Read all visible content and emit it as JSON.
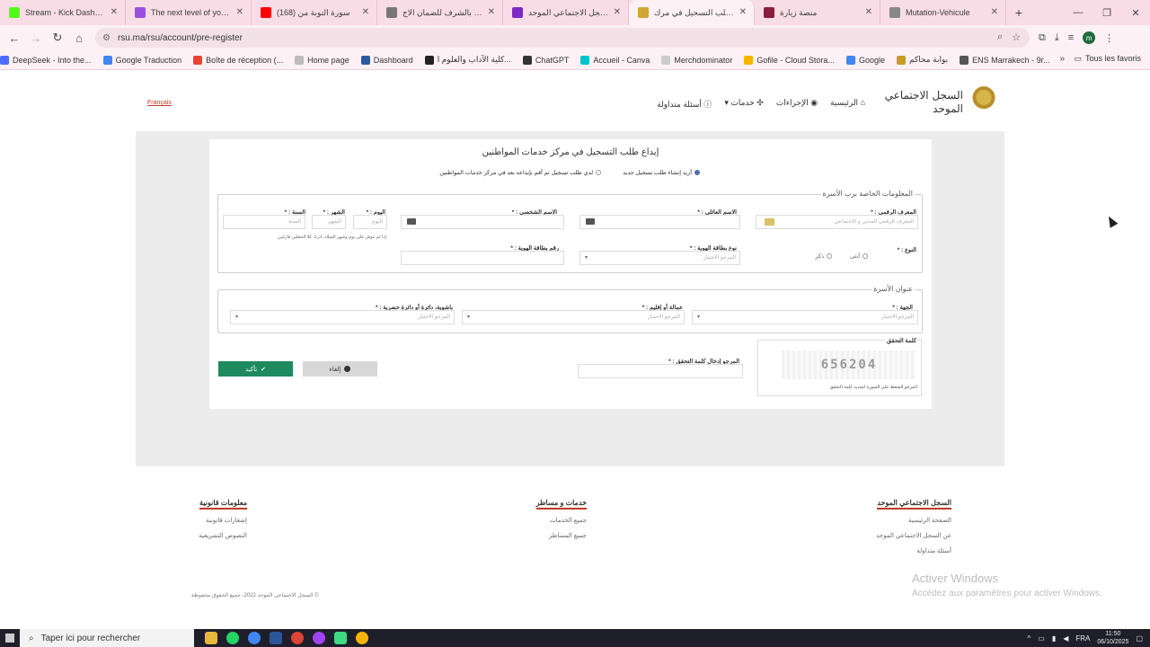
{
  "browser": {
    "tabs": [
      {
        "title": "Stream - Kick Dashboard",
        "favicon_color": "#53fc18",
        "active": false
      },
      {
        "title": "The next level of your cre",
        "favicon_color": "#9b51e0",
        "active": false
      },
      {
        "title": "(168) سورة التوبة من",
        "favicon_color": "#ff0000",
        "active": false
      },
      {
        "title": "تصريح بالشرف للضمان الاج",
        "favicon_color": "#777777",
        "active": false
      },
      {
        "title": "السجل الاجتماعي الموحد -",
        "favicon_color": "#7b2cbf",
        "active": false
      },
      {
        "title": "إيداع طلب التسجيل في مرك",
        "favicon_color": "#d4a537",
        "active": true
      },
      {
        "title": "منصة زيارة",
        "favicon_color": "#8a1c3d",
        "active": false
      },
      {
        "title": "Mutation-Vehicule",
        "favicon_color": "#888888",
        "active": false
      }
    ],
    "url": "rsu.ma/rsu/account/pre-register",
    "bookmarks": [
      {
        "label": "DeepSeek - Into the...",
        "color": "#4d6bfe"
      },
      {
        "label": "Google Traduction",
        "color": "#4285f4"
      },
      {
        "label": "Boîte de réception (...",
        "color": "#ea4335"
      },
      {
        "label": "Home page",
        "color": "#bbbbbb"
      },
      {
        "label": "Dashboard",
        "color": "#2c5aa0"
      },
      {
        "label": "كلية الآداب والعلوم ا...",
        "color": "#222222"
      },
      {
        "label": "ChatGPT",
        "color": "#333333"
      },
      {
        "label": "Accueil - Canva",
        "color": "#00c4cc"
      },
      {
        "label": "Merchdominator",
        "color": "#cccccc"
      },
      {
        "label": "Gofile - Cloud Stora...",
        "color": "#f4b400"
      },
      {
        "label": "Google",
        "color": "#4285f4"
      },
      {
        "label": "بوابة محاكم",
        "color": "#c89b2a"
      },
      {
        "label": "ENS Marrakech - 9r...",
        "color": "#555555"
      }
    ],
    "all_bookmarks": "Tous les favoris"
  },
  "header": {
    "lang_link": "Français",
    "nav": [
      "الرئيسية",
      "الإجراءات",
      "خدمات",
      "أسئلة متداولة"
    ],
    "logo_line1": "السجل الاجتماعي",
    "logo_line2": "الموحد"
  },
  "form": {
    "title": "إيداع طلب التسجيل في مركز خدمات المواطنين",
    "radio_new": "أريد إنشاء طلب تسجيل جديد",
    "radio_existing": "لدي طلب تسجيل تم أقم بإيداعه بعد في مركز خدمات المواطنين",
    "section_head": "المعلومات الخاصة برب الأسرة",
    "fields": {
      "digital_id_label": "المعرف الرقمي : *",
      "digital_id_placeholder": "المعرف الرقمي المدني و الاجتماعي",
      "family_name_label": "الاسم العائلي : *",
      "first_name_label": "الاسم الشخصي : *",
      "day_label": "اليوم : *",
      "day_placeholder": "اليوم",
      "month_label": "الشهر : *",
      "month_placeholder": "الشهر",
      "year_label": "السنة : *",
      "year_placeholder": "السنة",
      "date_hint": "إذا لم تتوفر على يوم وشهر الميلاد، اترك كلا الحقلين فارغين",
      "gender_label": "النوع : *",
      "gender_female": "أنثى",
      "gender_male": "ذكر",
      "id_type_label": "نوع بطاقة الهوية : *",
      "id_type_placeholder": "المرجو الاختيار",
      "id_number_label": "رقم بطاقة الهوية : *"
    },
    "address_head": "عنوان الأسرة",
    "address": {
      "region_label": "الجهة : *",
      "region_placeholder": "المرجو الاختيار",
      "province_label": "عمالة أو إقليم : *",
      "province_placeholder": "المرجو الاختيار",
      "pashalik_label": "باشوية، دائرة أو دائرة حضرية : *",
      "pashalik_placeholder": "المرجو الاختيار"
    },
    "captcha_label": "كلمة التحقق",
    "captcha_code": "656204",
    "captcha_caption": "المرجو الضغط على الصورة لتجديد كلمة التحقق",
    "captcha_input_label": "المرجو إدخال كلمة التحقق : *",
    "confirm_button": "تأكيد",
    "cancel_button": "إلغاء"
  },
  "footer": {
    "col1_title": "السجل الاجتماعي الموحد",
    "col1_links": [
      "الصفحة الرئيسية",
      "عن السجل الاجتماعي الموحد",
      "أسئلة متداولة"
    ],
    "col2_title": "خدمات و مساطر",
    "col2_links": [
      "جميع الخدمات",
      "جميع المساطر"
    ],
    "col3_title": "معلومات قانونية",
    "col3_links": [
      "إشعارات قانونية",
      "النصوص التشريعية"
    ],
    "copyright": "© السجل الاجتماعي الموحد 2022، جميع الحقوق محفوظة",
    "activate_line1": "Activer Windows",
    "activate_line2": "Accédez aux paramètres pour activer Windows."
  },
  "taskbar": {
    "search_placeholder": "Taper ici pour rechercher",
    "lang": "FRA",
    "time": "11:50",
    "date": "06/10/2025"
  }
}
